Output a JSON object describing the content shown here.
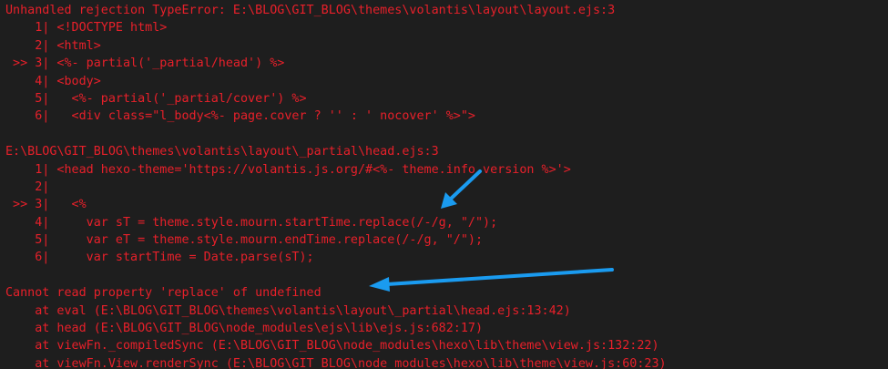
{
  "terminal": {
    "text_color": "#e8202a",
    "background": "#1e1e1e",
    "lines": [
      "Unhandled rejection TypeError: E:\\BLOG\\GIT_BLOG\\themes\\volantis\\layout\\layout.ejs:3",
      "    1| <!DOCTYPE html>",
      "    2| <html>",
      " >> 3| <%- partial('_partial/head') %>",
      "    4| <body>",
      "    5|   <%- partial('_partial/cover') %>",
      "    6|   <div class=\"l_body<%- page.cover ? '' : ' nocover' %>\">",
      "",
      "E:\\BLOG\\GIT_BLOG\\themes\\volantis\\layout\\_partial\\head.ejs:3",
      "    1| <head hexo-theme='https://volantis.js.org/#<%- theme.info.version %>'>",
      "    2|",
      " >> 3|   <%",
      "    4|     var sT = theme.style.mourn.startTime.replace(/-/g, \"/\");",
      "    5|     var eT = theme.style.mourn.endTime.replace(/-/g, \"/\");",
      "    6|     var startTime = Date.parse(sT);",
      "",
      "Cannot read property 'replace' of undefined",
      "    at eval (E:\\BLOG\\GIT_BLOG\\themes\\volantis\\layout\\_partial\\head.ejs:13:42)",
      "    at head (E:\\BLOG\\GIT_BLOG\\node_modules\\ejs\\lib\\ejs.js:682:17)",
      "    at viewFn._compiledSync (E:\\BLOG\\GIT_BLOG\\node_modules\\hexo\\lib\\theme\\view.js:132:22)",
      "    at viewFn.View.renderSync (E:\\BLOG\\GIT_BLOG\\node_modules\\hexo\\lib\\theme\\view.js:60:23)"
    ]
  },
  "annotations": {
    "arrow_color": "#1a9bf0"
  }
}
